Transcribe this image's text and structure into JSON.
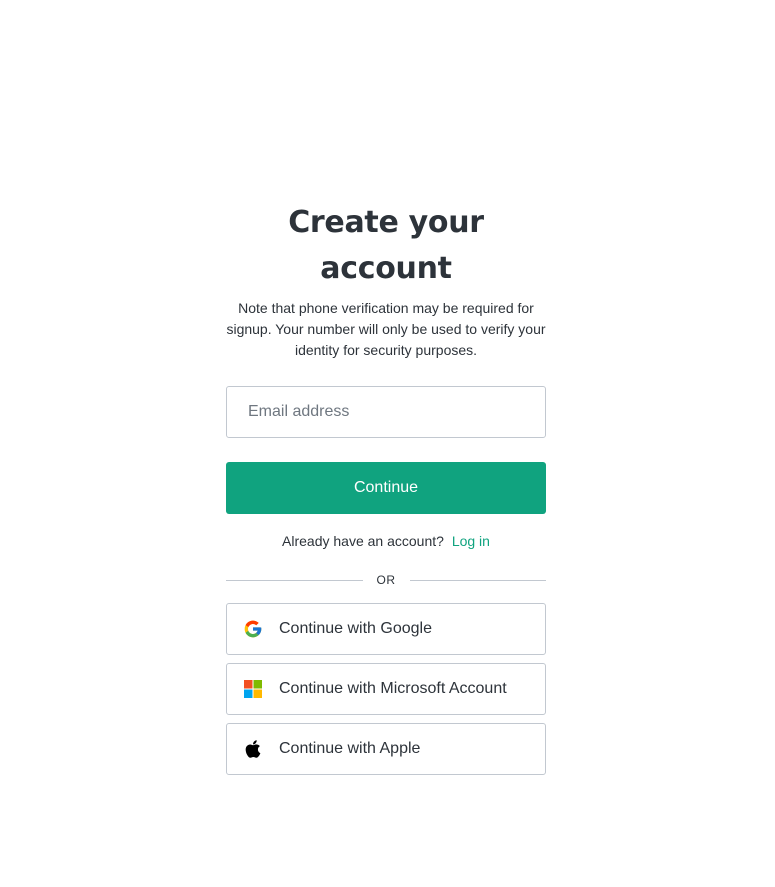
{
  "signup": {
    "title": "Create your account",
    "note": "Note that phone verification may be required for signup. Your number will only be used to verify your identity for security purposes.",
    "email": {
      "placeholder": "Email address",
      "value": ""
    },
    "continue_label": "Continue",
    "login_prompt": "Already have an account?",
    "login_link": "Log in",
    "divider_text": "OR",
    "social": [
      {
        "label": "Continue with Google",
        "icon": "google-icon"
      },
      {
        "label": "Continue with Microsoft Account",
        "icon": "microsoft-icon"
      },
      {
        "label": "Continue with Apple",
        "icon": "apple-icon"
      }
    ]
  },
  "colors": {
    "accent": "#10a37f",
    "text": "#2d333a",
    "border": "#c2c8d0"
  }
}
